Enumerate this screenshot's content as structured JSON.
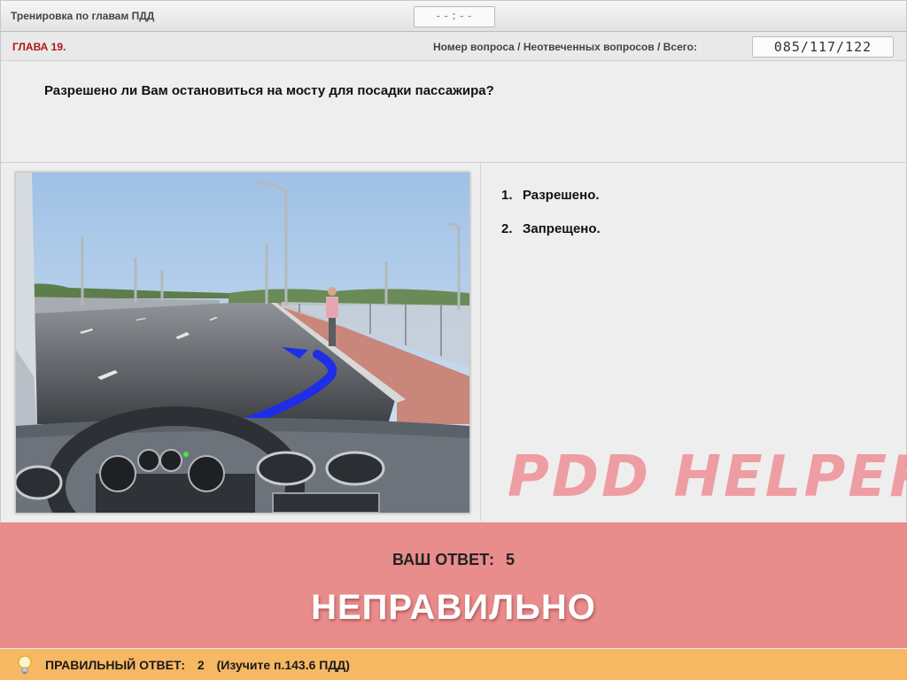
{
  "header": {
    "mode_title": "Тренировка по главам ПДД",
    "timer": "--:--"
  },
  "chapter_bar": {
    "chapter": "ГЛАВА 19.",
    "counter_label": "Номер вопроса / Неотвеченных вопросов / Всего:",
    "counter_value": "085/117/122"
  },
  "question": {
    "text": "Разрешено ли Вам остановиться на мосту для посадки пассажира?"
  },
  "answers": [
    {
      "number": "1.",
      "label": "Разрешено."
    },
    {
      "number": "2.",
      "label": "Запрещено."
    }
  ],
  "watermark": "PDD HELPER",
  "result": {
    "your_answer_label": "ВАШ ОТВЕТ:",
    "your_answer_value": "5",
    "verdict": "НЕПРАВИЛЬНО"
  },
  "correct": {
    "label": "ПРАВИЛЬНЫЙ ОТВЕТ:",
    "value": "2",
    "hint": "(Изучите п.143.6 ПДД)"
  },
  "colors": {
    "chapter_red": "#b0151a",
    "result_band": "#e98c8c",
    "correct_band": "#f6b863",
    "watermark": "#ef8f95"
  },
  "icons": {
    "hint": "lightbulb-icon",
    "path_arrow": "blue-arrow-icon"
  }
}
